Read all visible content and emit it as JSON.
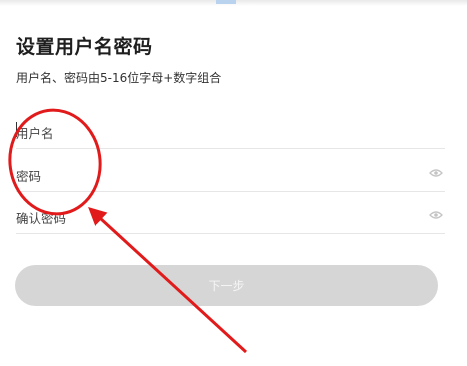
{
  "page": {
    "title": "设置用户名密码",
    "subtitle": "用户名、密码由5-16位字母+数字组合"
  },
  "form": {
    "username_placeholder": "用户名",
    "password_placeholder": "密码",
    "confirm_placeholder": "确认密码"
  },
  "next_button": {
    "label": "下一步"
  },
  "annotation": {
    "color": "#e11b1b"
  }
}
